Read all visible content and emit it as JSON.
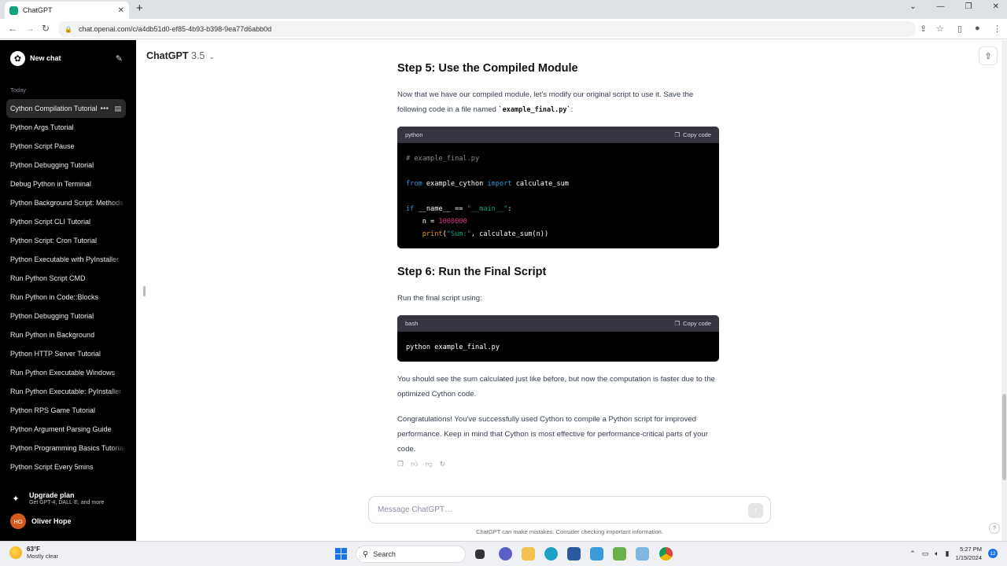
{
  "browser": {
    "tab_title": "ChatGPT",
    "url": "chat.openai.com/c/a4db51d0-ef85-4b93-b398-9ea77d6abb0d"
  },
  "sidebar": {
    "new_chat": "New chat",
    "section_label": "Today",
    "items": [
      {
        "label": "Cython Compilation Tutorial"
      },
      {
        "label": "Python Args Tutorial"
      },
      {
        "label": "Python Script Pause"
      },
      {
        "label": "Python Debugging Tutorial"
      },
      {
        "label": "Debug Python in Terminal"
      },
      {
        "label": "Python Background Script: Methods"
      },
      {
        "label": "Python Script CLI Tutorial"
      },
      {
        "label": "Python Script: Cron Tutorial"
      },
      {
        "label": "Python Executable with PyInstaller"
      },
      {
        "label": "Run Python Script CMD"
      },
      {
        "label": "Run Python in Code::Blocks"
      },
      {
        "label": "Python Debugging Tutorial"
      },
      {
        "label": "Run Python in Background"
      },
      {
        "label": "Python HTTP Server Tutorial"
      },
      {
        "label": "Run Python Executable Windows"
      },
      {
        "label": "Run Python Executable: PyInstaller"
      },
      {
        "label": "Python RPS Game Tutorial"
      },
      {
        "label": "Python Argument Parsing Guide"
      },
      {
        "label": "Python Programming Basics Tutorial"
      },
      {
        "label": "Python Script Every 5mins"
      }
    ],
    "upgrade_title": "Upgrade plan",
    "upgrade_sub": "Get GPT-4, DALL·E, and more",
    "user_initials": "HO",
    "user_name": "Oliver Hope"
  },
  "header": {
    "model": "ChatGPT",
    "version": "3.5"
  },
  "content": {
    "step5_title": "Step 5: Use the Compiled Module",
    "step5_text_a": "Now that we have our compiled module, let's modify our original script to use it. Save the following code in a file named ",
    "step5_code_inline": "`example_final.py`",
    "step5_text_b": ":",
    "code1_lang": "python",
    "copy_label": "Copy code",
    "code1": {
      "l1": "# example_final.py",
      "l3_kw1": "from",
      "l3_mod": " example_cython ",
      "l3_kw2": "import",
      "l3_name": " calculate_sum",
      "l5_kw": "if",
      "l5_mid": " __name__ == ",
      "l5_str": "\"__main__\"",
      "l5_end": ":",
      "l6_pre": "    n = ",
      "l6_num": "1000000",
      "l7_indent": "    ",
      "l7_fn": "print",
      "l7_open": "(",
      "l7_str": "\"Sum:\"",
      "l7_rest": ", calculate_sum(n))"
    },
    "step6_title": "Step 6: Run the Final Script",
    "step6_text": "Run the final script using:",
    "code2_lang": "bash",
    "code2_line": "python example_final.py",
    "para1": "You should see the sum calculated just like before, but now the computation is faster due to the optimized Cython code.",
    "para2": "Congratulations! You've successfully used Cython to compile a Python script for improved performance. Keep in mind that Cython is most effective for performance-critical parts of your code."
  },
  "composer": {
    "placeholder": "Message ChatGPT…",
    "disclaimer": "ChatGPT can make mistakes. Consider checking important information."
  },
  "taskbar": {
    "temp": "63°F",
    "weather": "Mostly clear",
    "search": "Search",
    "time": "5:27 PM",
    "date": "1/15/2024",
    "notifications": "12"
  },
  "colors": {
    "sidebar_bg": "#000000",
    "code_header": "#343541",
    "keyword": "#2e95d3",
    "string": "#00a67d",
    "number": "#df3079",
    "builtin": "#e9950c"
  },
  "icons": [
    "lock-icon",
    "star-icon",
    "edit-icon",
    "archive-icon",
    "share-icon",
    "copy-icon",
    "thumbs-up-icon",
    "thumbs-down-icon",
    "regenerate-icon",
    "send-icon"
  ]
}
